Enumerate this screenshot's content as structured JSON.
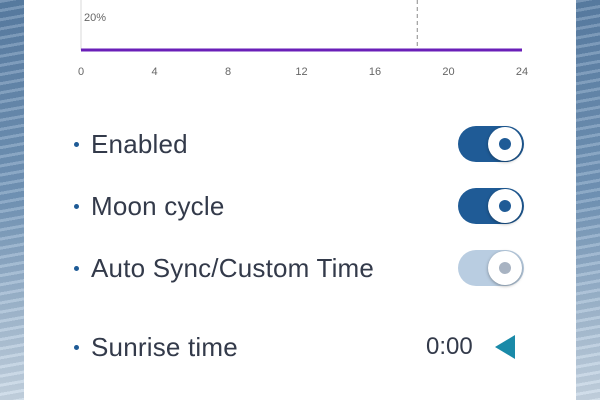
{
  "chart_data": {
    "type": "line",
    "x": [
      0,
      24
    ],
    "y_tick_label": "20%",
    "x_ticks": [
      "0",
      "4",
      "8",
      "12",
      "16",
      "20",
      "24"
    ],
    "xlim": [
      0,
      24
    ],
    "current_time_marker": 18.3,
    "line_color": "#6a1fb8"
  },
  "settings": {
    "enabled": {
      "label": "Enabled",
      "state": "on"
    },
    "moon_cycle": {
      "label": "Moon cycle",
      "state": "on"
    },
    "auto_sync": {
      "label": "Auto Sync/Custom Time",
      "state": "disabled"
    },
    "sunrise": {
      "label": "Sunrise time",
      "value": "0:00",
      "arrow_icon": "triangle-left-icon"
    }
  },
  "colors": {
    "accent": "#1f5b96",
    "toggle_disabled": "#b9cde1",
    "arrow": "#1a8aa8",
    "text": "#333a4a"
  }
}
